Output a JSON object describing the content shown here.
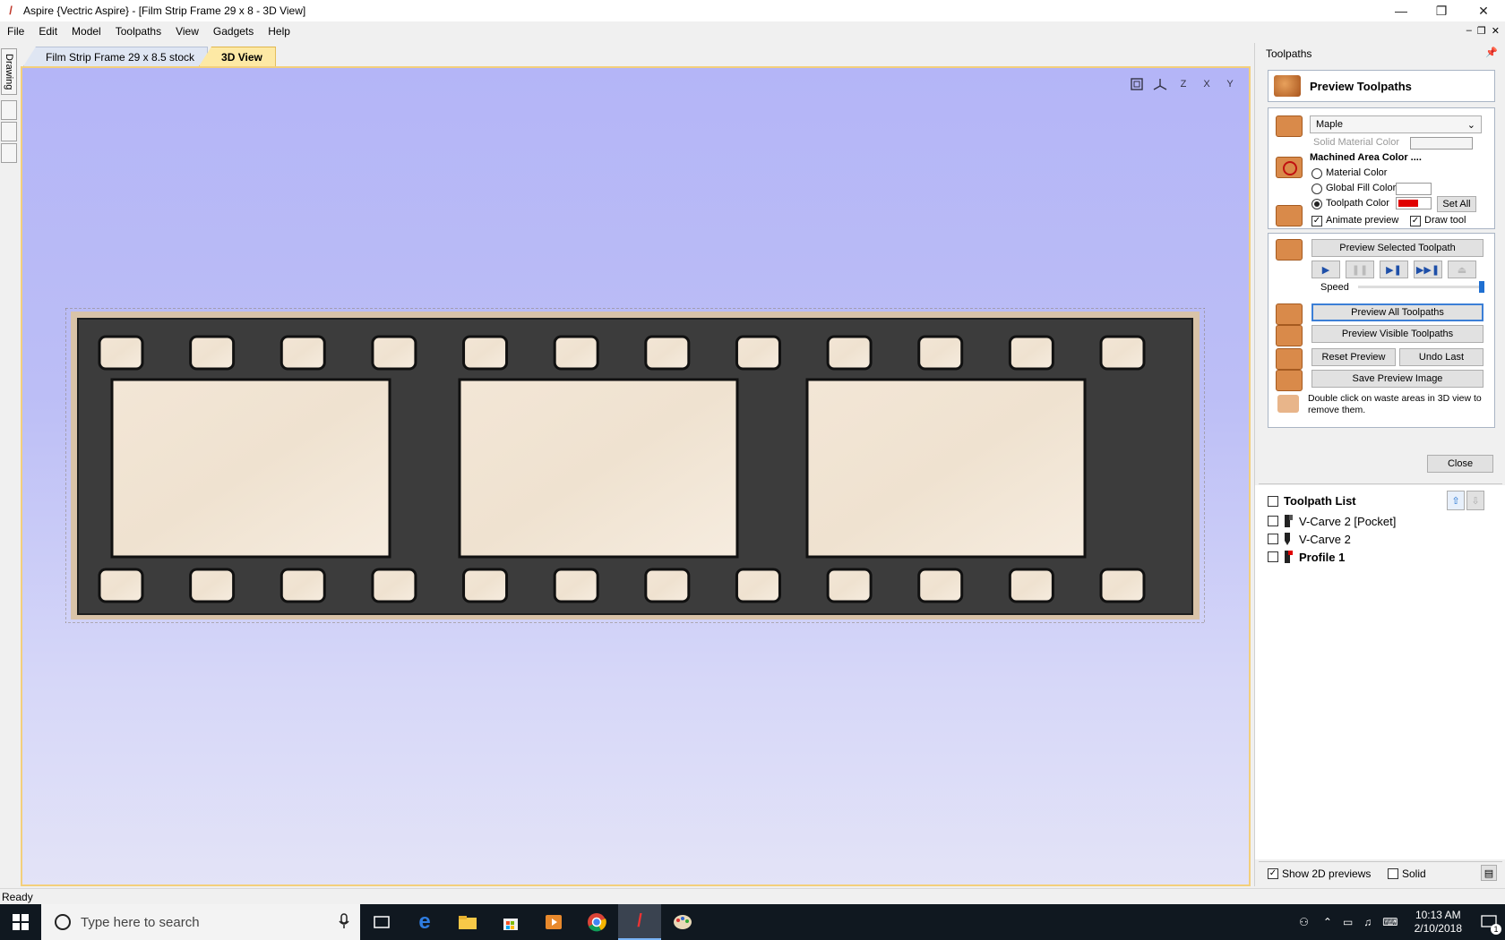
{
  "window": {
    "title": "Aspire {Vectric Aspire} - [Film Strip Frame 29 x 8 - 3D View]",
    "minimize": "—",
    "restore": "❐",
    "close": "✕"
  },
  "menu": [
    "File",
    "Edit",
    "Model",
    "Toolpaths",
    "View",
    "Gadgets",
    "Help"
  ],
  "left_strip": {
    "drawing_tab": "Drawing"
  },
  "doc_tabs": [
    {
      "label": "Film Strip Frame 29 x 8.5 stock",
      "active": false
    },
    {
      "label": "3D View",
      "active": true
    }
  ],
  "view_toolbar": [
    "zoom-extents-icon",
    "iso-view-icon",
    "view-z-icon",
    "view-x-icon",
    "view-y-icon"
  ],
  "view_toolbar_labels": {
    "z": "Z",
    "x": "X",
    "y": "Y"
  },
  "film_strip": {
    "top_holes": 12,
    "bottom_holes": 12,
    "frames": 3
  },
  "panel": {
    "title": "Toolpaths",
    "preview_title": "Preview Toolpaths",
    "material": "Maple",
    "solid_material_color": "Solid Material Color",
    "machined_area_color": "Machined Area Color ....",
    "radio_material_color": "Material Color",
    "radio_global_fill": "Global Fill Color",
    "radio_toolpath_color": "Toolpath Color",
    "set_all": "Set All",
    "animate_preview": "Animate preview",
    "draw_tool": "Draw tool",
    "preview_selected": "Preview Selected Toolpath",
    "speed": "Speed",
    "preview_all": "Preview All Toolpaths",
    "preview_visible": "Preview Visible Toolpaths",
    "reset_preview": "Reset Preview",
    "undo_last": "Undo Last",
    "save_preview_image": "Save Preview Image",
    "hint": "Double click on waste areas in 3D view to remove them.",
    "close": "Close",
    "toolpath_list_title": "Toolpath List",
    "toolpaths": [
      {
        "name": "V-Carve 2 [Pocket]",
        "bold": false
      },
      {
        "name": "V-Carve 2",
        "bold": false
      },
      {
        "name": "Profile 1",
        "bold": true
      }
    ],
    "show_2d_previews": "Show 2D previews",
    "solid": "Solid"
  },
  "colors": {
    "accent": "#3c7fd6",
    "toolpath_color": "#e00000",
    "tab_active": "#fde9a5",
    "view_border": "#f3cf7b"
  },
  "status": {
    "text": "Ready"
  },
  "taskbar": {
    "search_placeholder": "Type here to search",
    "time": "10:13 AM",
    "date": "2/10/2018",
    "notification_count": "1"
  }
}
